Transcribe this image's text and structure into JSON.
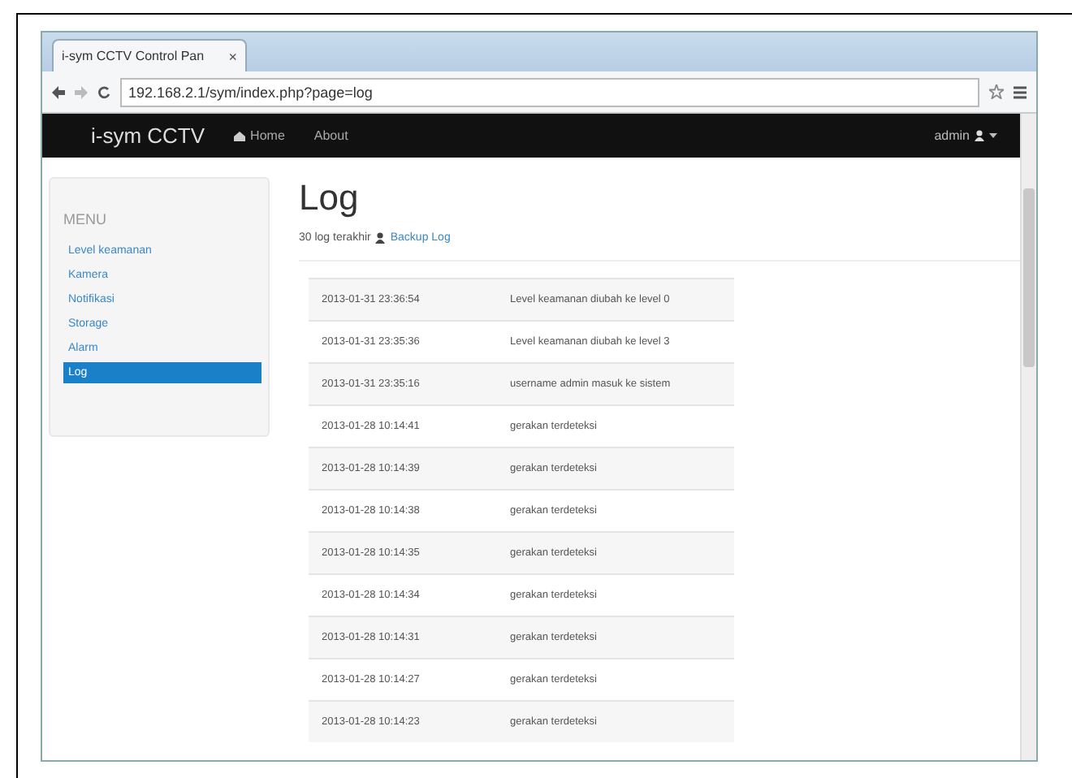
{
  "browser": {
    "tab_title": "i-sym CCTV Control Pan",
    "tab_close": "×",
    "address": "192.168.2.1/sym/index.php?page=log"
  },
  "navbar": {
    "brand": "i-sym CCTV",
    "links": [
      {
        "label": "Home",
        "icon": true
      },
      {
        "label": "About",
        "icon": false
      }
    ],
    "user": "admin"
  },
  "sidebar": {
    "heading": "MENU",
    "items": [
      {
        "label": "Level keamanan",
        "selected": false
      },
      {
        "label": "Kamera",
        "selected": false
      },
      {
        "label": "Notifikasi",
        "selected": false
      },
      {
        "label": "Storage",
        "selected": false
      },
      {
        "label": "Alarm",
        "selected": false
      },
      {
        "label": "Log",
        "selected": true
      }
    ]
  },
  "main": {
    "title": "Log",
    "subtitle": "30 log terakhir",
    "backup_link": "Backup Log"
  },
  "table": {
    "rows": [
      [
        "2013-01-31 23:36:54",
        "Level keamanan diubah ke level 0"
      ],
      [
        "2013-01-31 23:35:36",
        "Level keamanan diubah ke level 3"
      ],
      [
        "2013-01-31 23:35:16",
        "username admin masuk ke sistem"
      ],
      [
        "2013-01-28 10:14:41",
        "gerakan terdeteksi"
      ],
      [
        "2013-01-28 10:14:39",
        "gerakan terdeteksi"
      ],
      [
        "2013-01-28 10:14:38",
        "gerakan terdeteksi"
      ],
      [
        "2013-01-28 10:14:35",
        "gerakan terdeteksi"
      ],
      [
        "2013-01-28 10:14:34",
        "gerakan terdeteksi"
      ],
      [
        "2013-01-28 10:14:31",
        "gerakan terdeteksi"
      ],
      [
        "2013-01-28 10:14:27",
        "gerakan terdeteksi"
      ],
      [
        "2013-01-28 10:14:23",
        "gerakan terdeteksi"
      ]
    ]
  }
}
